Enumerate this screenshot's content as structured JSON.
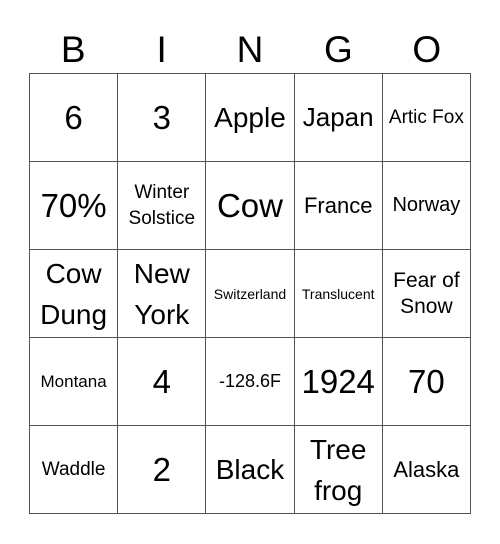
{
  "header": {
    "letters": [
      "B",
      "I",
      "N",
      "G",
      "O"
    ]
  },
  "cells": [
    [
      "6",
      "3",
      "Apple",
      "Japan",
      "Artic Fox"
    ],
    [
      "70%",
      "Winter Solstice",
      "Cow",
      "France",
      "Norway"
    ],
    [
      "Cow Dung",
      "New York",
      "Switzerland",
      "Translucent",
      "Fear of Snow"
    ],
    [
      "Montana",
      "4",
      "-128.6F",
      "1924",
      "70"
    ],
    [
      "Waddle",
      "2",
      "Black",
      "Tree frog",
      "Alaska"
    ]
  ],
  "colors": {
    "grid_line": "#555555",
    "text": "#000000",
    "background": "#ffffff"
  }
}
